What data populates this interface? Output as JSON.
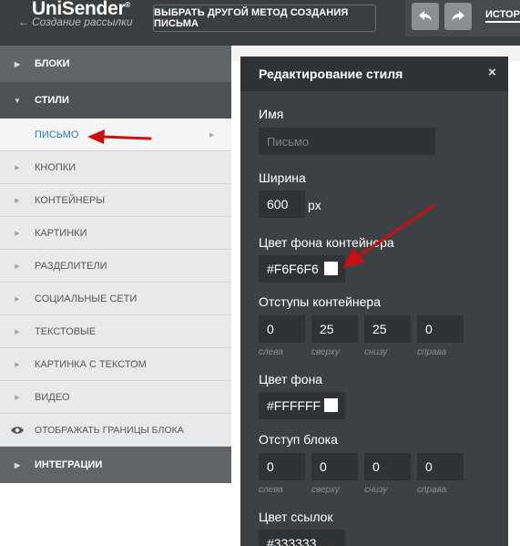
{
  "colors": {
    "topbar": "#3b3e41",
    "panel": "#3e4144",
    "accent_link": "#2e7db6",
    "annotation_arrow": "#c81010"
  },
  "header": {
    "logo": "UniSender",
    "logo_mark": "®",
    "subtitle": "Создание рассылки",
    "back_icon": "arrow-left-icon",
    "method_button": "ВЫБРАТЬ ДРУГОЙ МЕТОД СОЗДАНИЯ ПИСЬМА",
    "undo_icon": "undo-icon",
    "redo_icon": "redo-icon",
    "history_label": "ИСТОРИ"
  },
  "sidebar": {
    "blocks": "БЛОКИ",
    "styles": "СТИЛИ",
    "items": [
      {
        "label": "ПИСЬМО",
        "active": true
      },
      {
        "label": "КНОПКИ"
      },
      {
        "label": "КОНТЕЙНЕРЫ"
      },
      {
        "label": "КАРТИНКИ"
      },
      {
        "label": "РАЗДЕЛИТЕЛИ"
      },
      {
        "label": "СОЦИАЛЬНЫЕ СЕТИ"
      },
      {
        "label": "ТЕКСТОВЫЕ"
      },
      {
        "label": "КАРТИНКА С ТЕКСТОМ"
      },
      {
        "label": "ВИДЕО"
      }
    ],
    "show_borders": "ОТОБРАЖАТЬ ГРАНИЦЫ БЛОКА",
    "integrations": "ИНТЕГРАЦИИ"
  },
  "panel": {
    "title": "Редактирование стиля",
    "close": "×",
    "name_label": "Имя",
    "name_placeholder": "Письмо",
    "width_label": "Ширина",
    "width_value": "600",
    "width_unit": "px",
    "container_bg_label": "Цвет фона контейнера",
    "container_bg_value": "#F6F6F6",
    "container_padding_label": "Отступы контейнера",
    "container_padding": [
      {
        "value": "0",
        "caption": "слева"
      },
      {
        "value": "25",
        "caption": "сверху"
      },
      {
        "value": "25",
        "caption": "снизу"
      },
      {
        "value": "0",
        "caption": "справа"
      }
    ],
    "bg_label": "Цвет фона",
    "bg_value": "#FFFFFF",
    "block_padding_label": "Отступ блока",
    "block_padding": [
      {
        "value": "0",
        "caption": "слева"
      },
      {
        "value": "0",
        "caption": "сверху"
      },
      {
        "value": "0",
        "caption": "снизу"
      },
      {
        "value": "0",
        "caption": "справа"
      }
    ],
    "link_color_label": "Цвет ссылок",
    "link_color_value": "#333333"
  }
}
